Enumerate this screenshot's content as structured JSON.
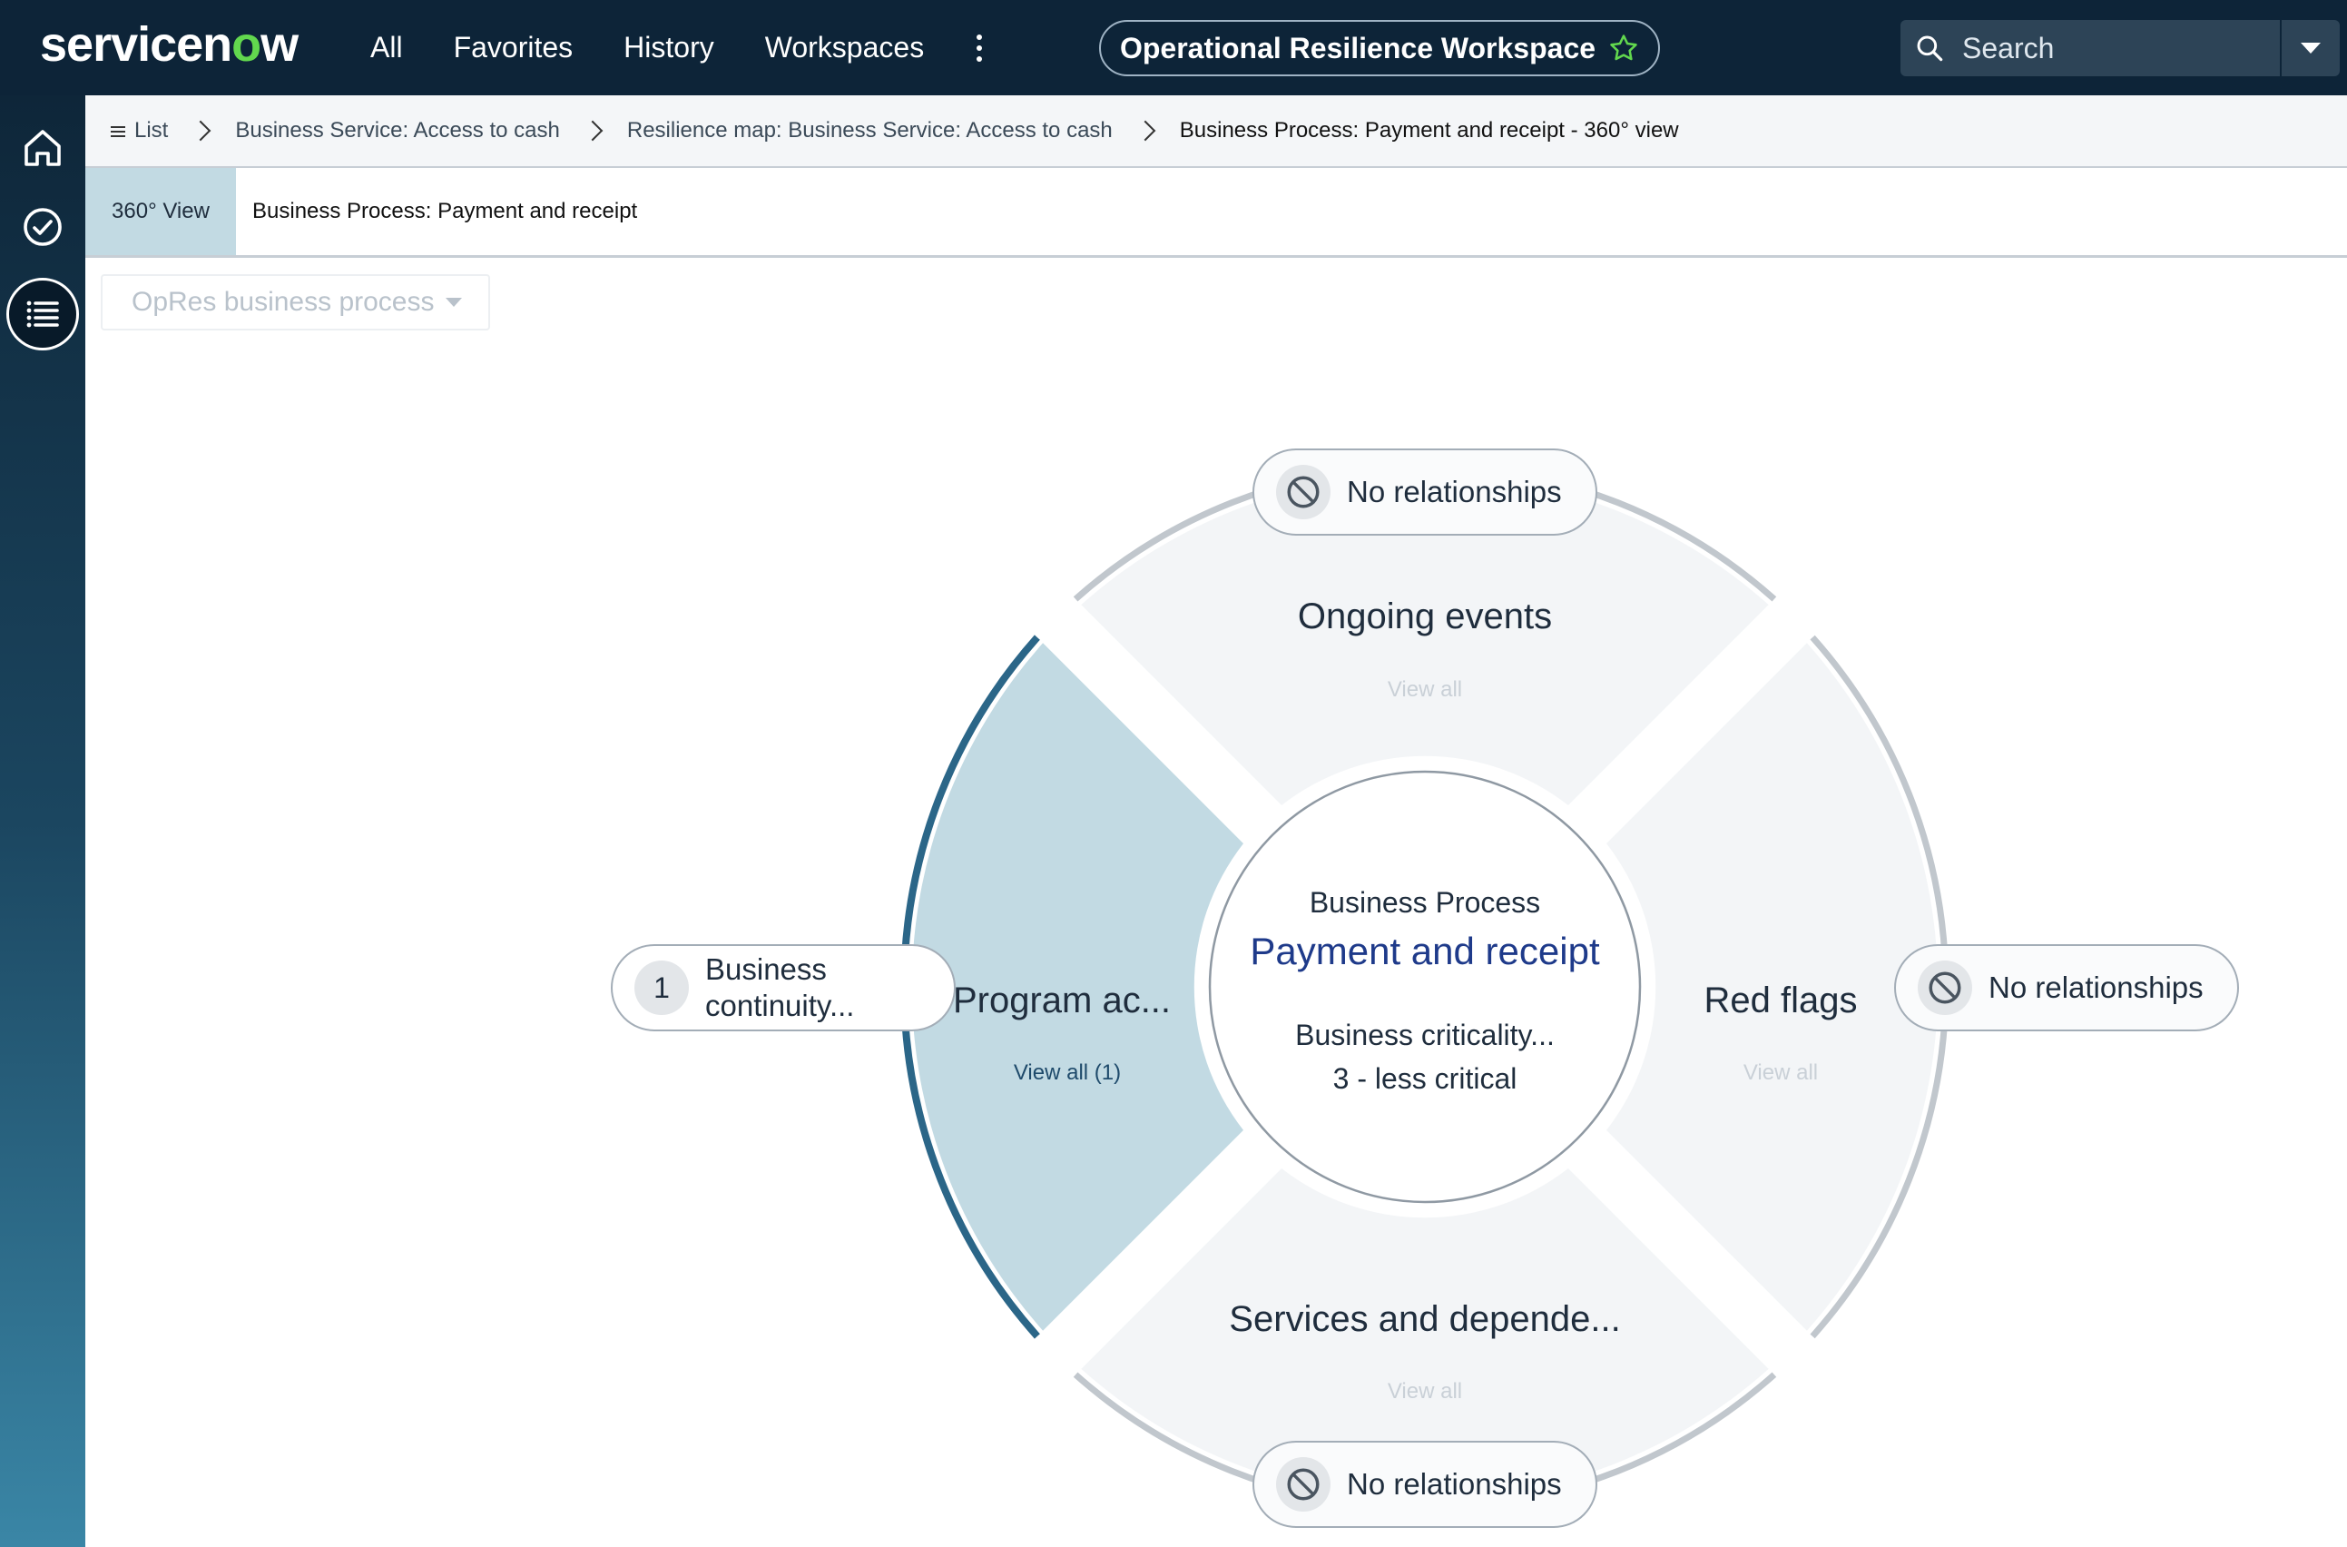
{
  "header": {
    "logo_prefix": "servicen",
    "logo_o": "o",
    "logo_suffix": "w",
    "nav": [
      "All",
      "Favorites",
      "History",
      "Workspaces"
    ],
    "workspace_label": "Operational Resilience Workspace",
    "search_placeholder": "Search"
  },
  "breadcrumbs": [
    "List",
    "Business Service: Access to cash",
    "Resilience map: Business Service: Access to cash",
    "Business Process: Payment and receipt - 360° view"
  ],
  "tab": {
    "label": "360° View",
    "title": "Business Process: Payment and receipt"
  },
  "filter": {
    "value": "OpRes business process"
  },
  "wheel": {
    "center": {
      "type_label": "Business Process",
      "name": "Payment and receipt",
      "criticality_label": "Business criticality...",
      "criticality_value": "3 - less critical"
    },
    "segments": {
      "top": {
        "title": "Ongoing events",
        "link": "View all",
        "relationships": "No relationships"
      },
      "right": {
        "title": "Red flags",
        "link": "View all",
        "relationships": "No relationships"
      },
      "bottom": {
        "title": "Services and depende...",
        "link": "View all",
        "relationships": "No relationships"
      },
      "left": {
        "title": "Program ac...",
        "link": "View all (1)",
        "count": "1",
        "item_line1": "Business",
        "item_line2": "continuity..."
      }
    }
  },
  "colors": {
    "topbar": "#0d2438",
    "logo_accent": "#62d84e",
    "active_segment": "#c2dae3",
    "active_arc": "#2b6688",
    "segment": "#f3f5f7"
  }
}
